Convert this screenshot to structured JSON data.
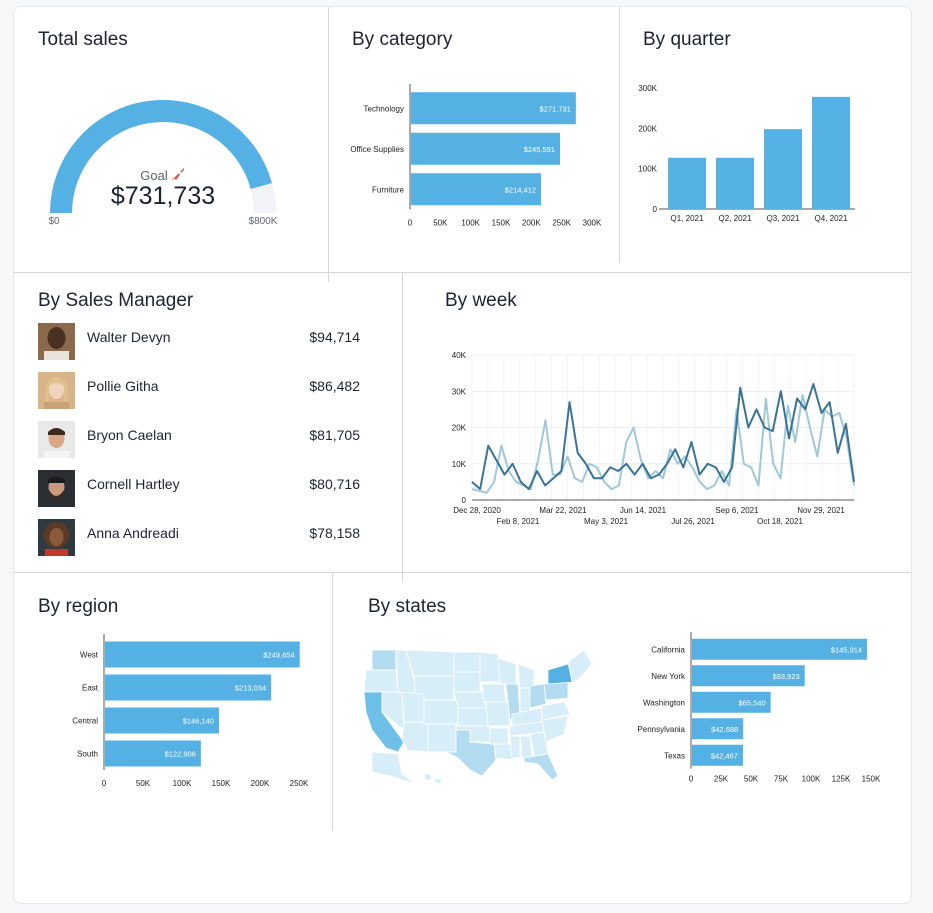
{
  "panels": {
    "total": {
      "title": "Total sales"
    },
    "category": {
      "title": "By category"
    },
    "quarter": {
      "title": "By quarter"
    },
    "managers": {
      "title": "By Sales Manager"
    },
    "week": {
      "title": "By week"
    },
    "region": {
      "title": "By region"
    },
    "states": {
      "title": "By states"
    }
  },
  "gauge": {
    "goal_label": "Goal",
    "goal_icon": "rocket-icon",
    "value": 731733,
    "value_text": "$731,733",
    "min_label": "$0",
    "max_label": "$800K",
    "min": 0,
    "max": 800000
  },
  "managers": [
    {
      "name": "Walter Devyn",
      "value": "$94,714"
    },
    {
      "name": "Pollie Githa",
      "value": "$86,482"
    },
    {
      "name": "Bryon Caelan",
      "value": "$81,705"
    },
    {
      "name": "Cornell Hartley",
      "value": "$80,716"
    },
    {
      "name": "Anna Andreadi",
      "value": "$78,158"
    }
  ],
  "colors": {
    "bar": "#55b0e4",
    "line_dark": "#3a7495",
    "line_light": "#9fc8da",
    "map_base": "#d7edf8",
    "map_mid": "#b3dcf0",
    "map_dark": "#6fc0e9"
  },
  "chart_data": [
    {
      "id": "category",
      "type": "bar",
      "orientation": "horizontal",
      "categories": [
        "Technology",
        "Office Supplies",
        "Furniture"
      ],
      "values": [
        271731,
        245591,
        214412
      ],
      "labels": [
        "$271,731",
        "$245,591",
        "$214,412"
      ],
      "xlim": [
        0,
        300000
      ],
      "ticks": [
        "0",
        "50K",
        "100K",
        "150K",
        "200K",
        "250K",
        "300K"
      ]
    },
    {
      "id": "quarter",
      "type": "bar",
      "orientation": "vertical",
      "categories": [
        "Q1, 2021",
        "Q2, 2021",
        "Q3, 2021",
        "Q4, 2021"
      ],
      "values": [
        127000,
        127000,
        198000,
        278000
      ],
      "ylim": [
        0,
        300000
      ],
      "ticks": [
        "0",
        "100K",
        "200K",
        "300K"
      ]
    },
    {
      "id": "week",
      "type": "line",
      "ylim": [
        0,
        40000
      ],
      "yticks": [
        "0",
        "10K",
        "20K",
        "30K",
        "40K"
      ],
      "xticks_row1": [
        "Dec 28, 2020",
        "Mar 22, 2021",
        "Jun 14, 2021",
        "Sep 6, 2021",
        "Nov 29, 2021"
      ],
      "xticks_row2": [
        "Feb 8, 2021",
        "May 3, 2021",
        "Jul 26, 2021",
        "Oct 18, 2021"
      ],
      "series": [
        {
          "values": [
            5000,
            3000,
            15000,
            11000,
            7000,
            10000,
            5000,
            3000,
            8000,
            4000,
            6000,
            8000,
            27000,
            13000,
            10000,
            6000,
            6000,
            9000,
            8000,
            10000,
            7000,
            10000,
            6000,
            7000,
            10000,
            14000,
            9000,
            16000,
            7000,
            10000,
            9000,
            5000,
            9000,
            31000,
            20000,
            25000,
            20000,
            19000,
            30000,
            17000,
            28000,
            25000,
            32000,
            24000,
            27000,
            13000,
            21000,
            5000
          ]
        },
        {
          "values": [
            3000,
            2500,
            2000,
            5000,
            15000,
            8000,
            5000,
            4000,
            3000,
            11000,
            22000,
            7000,
            7000,
            12000,
            6000,
            5000,
            10000,
            9000,
            5000,
            3000,
            4000,
            16000,
            20000,
            11000,
            6000,
            8000,
            6000,
            14000,
            10000,
            12000,
            9000,
            5000,
            3000,
            4000,
            8000,
            4000,
            25000,
            10000,
            9000,
            4000,
            28000,
            10000,
            6000,
            26000,
            16000,
            29000,
            20000,
            12000,
            25000,
            23000,
            24000,
            17000,
            4000
          ]
        }
      ]
    },
    {
      "id": "region",
      "type": "bar",
      "orientation": "horizontal",
      "categories": [
        "West",
        "East",
        "Central",
        "South"
      ],
      "values": [
        249654,
        213034,
        146140,
        122906
      ],
      "labels": [
        "$249,654",
        "$213,034",
        "$146,140",
        "$122,906"
      ],
      "xlim": [
        0,
        250000
      ],
      "ticks": [
        "0",
        "50K",
        "100K",
        "150K",
        "200K",
        "250K"
      ]
    },
    {
      "id": "states",
      "type": "bar",
      "orientation": "horizontal",
      "categories": [
        "California",
        "New York",
        "Washington",
        "Pennsylvania",
        "Texas"
      ],
      "values": [
        145914,
        93923,
        65540,
        42688,
        42467
      ],
      "labels": [
        "$145,914",
        "$93,923",
        "$65,540",
        "$42,688",
        "$42,467"
      ],
      "xlim": [
        0,
        150000
      ],
      "ticks": [
        "0",
        "25K",
        "50K",
        "75K",
        "100K",
        "125K",
        "150K"
      ]
    }
  ]
}
